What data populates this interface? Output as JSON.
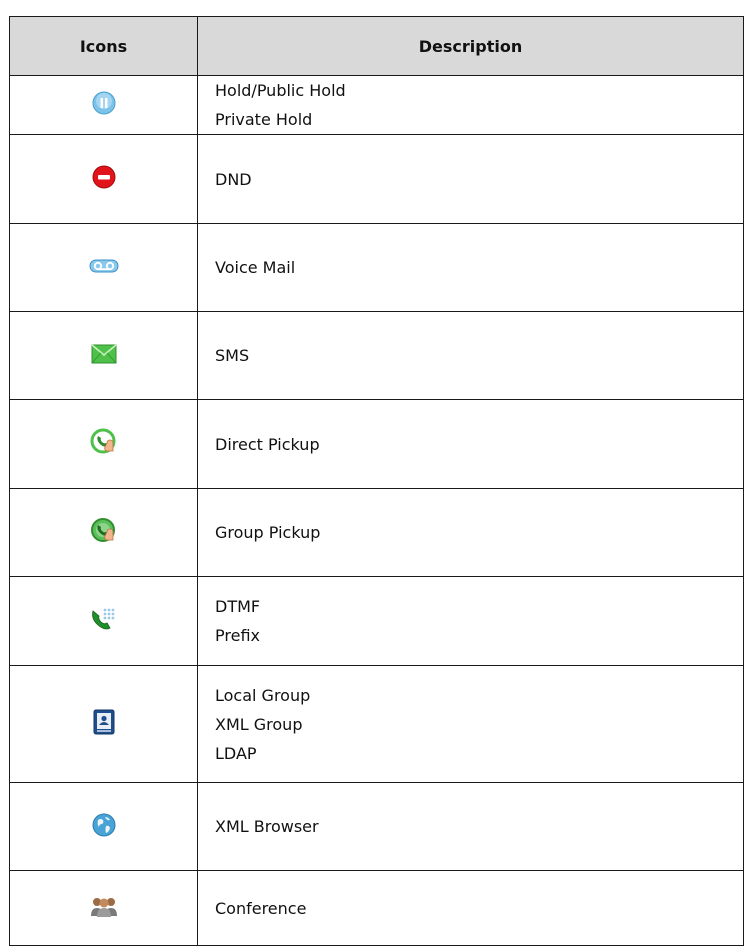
{
  "table": {
    "headers": {
      "icons": "Icons",
      "description": "Description"
    },
    "rows": [
      {
        "icon": "hold-icon",
        "lines": [
          "Hold/Public Hold",
          "Private Hold"
        ]
      },
      {
        "icon": "dnd-icon",
        "lines": [
          "DND"
        ]
      },
      {
        "icon": "voicemail-icon",
        "lines": [
          "Voice Mail"
        ]
      },
      {
        "icon": "sms-icon",
        "lines": [
          "SMS"
        ]
      },
      {
        "icon": "direct-pickup-icon",
        "lines": [
          "Direct Pickup"
        ]
      },
      {
        "icon": "group-pickup-icon",
        "lines": [
          "Group Pickup"
        ]
      },
      {
        "icon": "dtmf-icon",
        "lines": [
          "DTMF",
          "Prefix"
        ]
      },
      {
        "icon": "directory-icon",
        "lines": [
          "Local Group",
          "XML Group",
          "LDAP"
        ]
      },
      {
        "icon": "xml-browser-icon",
        "lines": [
          "XML Browser"
        ]
      },
      {
        "icon": "conference-icon",
        "lines": [
          "Conference"
        ]
      }
    ]
  }
}
